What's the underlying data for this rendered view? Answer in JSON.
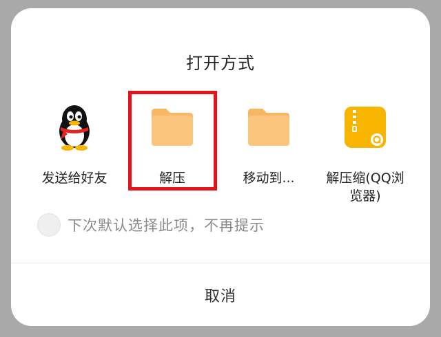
{
  "dialog": {
    "title": "打开方式",
    "apps": [
      {
        "label": "发送给好友",
        "icon": "qq-penguin-icon"
      },
      {
        "label": "解压",
        "icon": "folder-icon",
        "selected": true
      },
      {
        "label": "移动到...",
        "icon": "folder-icon"
      },
      {
        "label_line1": "解压缩(QQ浏",
        "label_line2": "览器)",
        "icon": "qq-browser-zip-icon"
      }
    ],
    "remember_label": "下次默认选择此项，不再提示",
    "cancel_label": "取消"
  },
  "colors": {
    "highlight": "#e0141a",
    "folder": "#f9c07a",
    "zip_icon": "#f8b500",
    "overlay": "#a9a9a9"
  }
}
